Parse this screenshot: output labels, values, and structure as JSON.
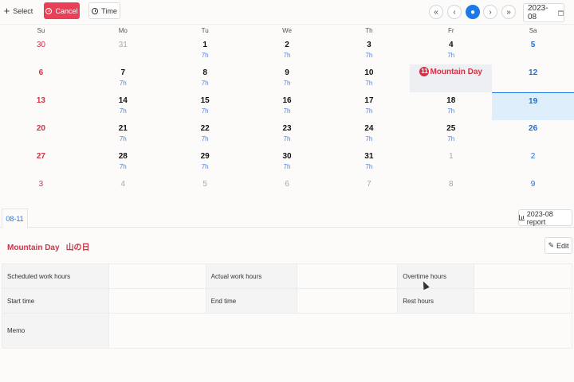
{
  "toolbar": {
    "select_label": "Select",
    "cancel_label": "Cancel",
    "time_label": "Time",
    "month_value": "2023-08",
    "accent_color": "#e94057",
    "today_color": "#1d79e8"
  },
  "calendar": {
    "weekdays": [
      "Su",
      "Mo",
      "Tu",
      "We",
      "Th",
      "Fr",
      "Sa"
    ],
    "weeks": [
      [
        {
          "n": "30",
          "o": true
        },
        {
          "n": "31",
          "o": true
        },
        {
          "n": "1",
          "h": "7h"
        },
        {
          "n": "2",
          "h": "7h"
        },
        {
          "n": "3",
          "h": "7h"
        },
        {
          "n": "4",
          "h": "7h"
        },
        {
          "n": "5"
        }
      ],
      [
        {
          "n": "6"
        },
        {
          "n": "7",
          "h": "7h"
        },
        {
          "n": "8",
          "h": "7h"
        },
        {
          "n": "9",
          "h": "7h"
        },
        {
          "n": "10",
          "h": "7h"
        },
        {
          "n": "11",
          "holiday": "Mountain Day"
        },
        {
          "n": "12"
        }
      ],
      [
        {
          "n": "13"
        },
        {
          "n": "14",
          "h": "7h"
        },
        {
          "n": "15",
          "h": "7h"
        },
        {
          "n": "16",
          "h": "7h"
        },
        {
          "n": "17",
          "h": "7h"
        },
        {
          "n": "18",
          "h": "7h"
        },
        {
          "n": "19",
          "selected": true
        }
      ],
      [
        {
          "n": "20"
        },
        {
          "n": "21",
          "h": "7h"
        },
        {
          "n": "22",
          "h": "7h"
        },
        {
          "n": "23",
          "h": "7h"
        },
        {
          "n": "24",
          "h": "7h"
        },
        {
          "n": "25",
          "h": "7h"
        },
        {
          "n": "26"
        }
      ],
      [
        {
          "n": "27"
        },
        {
          "n": "28",
          "h": "7h"
        },
        {
          "n": "29",
          "h": "7h"
        },
        {
          "n": "30",
          "h": "7h"
        },
        {
          "n": "31",
          "h": "7h"
        },
        {
          "n": "1",
          "o": true
        },
        {
          "n": "2",
          "o": true
        }
      ],
      [
        {
          "n": "3",
          "o": true
        },
        {
          "n": "4",
          "o": true
        },
        {
          "n": "5",
          "o": true
        },
        {
          "n": "6",
          "o": true
        },
        {
          "n": "7",
          "o": true
        },
        {
          "n": "8",
          "o": true
        },
        {
          "n": "9",
          "o": true
        }
      ]
    ]
  },
  "detail": {
    "tab_label": "08-11",
    "report_label": "2023-08 report",
    "holiday_en": "Mountain Day",
    "holiday_jp": "山の日",
    "edit_label": "Edit",
    "rows": {
      "scheduled": "Scheduled work hours",
      "actual": "Actual work hours",
      "overtime": "Overtime hours",
      "start": "Start time",
      "end": "End time",
      "rest": "Rest hours",
      "memo": "Memo"
    }
  },
  "icons": {
    "select": "plus-icon",
    "cancel": "cancel-circle-icon",
    "time": "clock-icon",
    "first": "double-chevron-left-icon",
    "prev": "chevron-left-icon",
    "today": "location-pin-icon",
    "next": "chevron-right-icon",
    "last": "double-chevron-right-icon",
    "calendar": "calendar-icon",
    "report": "bar-chart-icon",
    "edit": "pencil-icon"
  }
}
